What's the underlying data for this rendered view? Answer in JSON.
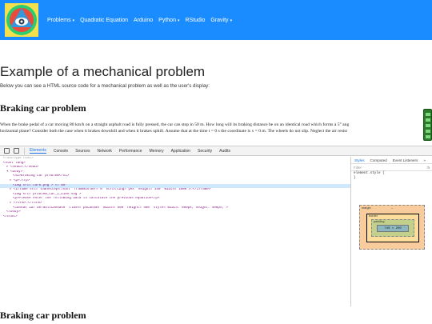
{
  "navbar": {
    "items": [
      {
        "label": "Problems",
        "caret": true
      },
      {
        "label": "Quadratic Equation",
        "caret": false
      },
      {
        "label": "Arduino",
        "caret": false
      },
      {
        "label": "Python",
        "caret": true
      },
      {
        "label": "RStudio",
        "caret": false
      },
      {
        "label": "Gravity",
        "caret": true
      }
    ],
    "caret_glyph": "▾"
  },
  "page": {
    "title": "Example of a mechanical problem",
    "intro": "Below you can see a HTML source code for a mechanical problem as well as the user's display:",
    "section_heading": "Braking car problem",
    "problem_line1": "When the brake pedal of a car moving 80 km/h on a straight asphalt road is fully pressed, the car can stop in 50 m. How long will its braking distance be on an identical road which forms a 5° ang",
    "problem_line2": "horizontal plane? Consider both the case when it brakes downhill and when it brakes uphill. Assume that at the time t = 0 s the coordinate is x = 0 m. The wheels do not slip. Neglect the air resist",
    "section_heading_2": "Braking car problem"
  },
  "devtools": {
    "tabs": [
      "Elements",
      "Console",
      "Sources",
      "Network",
      "Performance",
      "Memory",
      "Application",
      "Security",
      "Audits"
    ],
    "active_tab": "Elements",
    "code": [
      "<!doctype html>",
      "<html lang>",
      "▸ <head>…</head>",
      "▾ <body>",
      "<h1>Braking car problem</h1>",
      "▸ <p>…</p>",
      "<img src=\"car0.png\"> == $0",
      "▸ <iframe src=\"loanvsteps.html\" frameborder=\"0\" scrolling=\"yes\" height=\"340\" width=\"1000\">…</iframe>",
      "<img src=\"problem_car_1_bien.svg\">",
      "<p>Please enter the following data to calculate the previous equation</p>",
      "▸ <form>…</form>",
      "<canvas id=\"defaultCanvas0\" class=\"p5Canvas\" width=\"600\" height=\"400\" style=\"width: 600px; height: 400px;\">",
      "</body>",
      "</html>"
    ],
    "styles": {
      "tabs": [
        "Styles",
        "Computed",
        "Event Listeners",
        "»"
      ],
      "filter_placeholder": "Filter",
      "filter_hint": ":h",
      "rule_selector": "element.style {",
      "rule_close": "}",
      "box_model": {
        "margin_label": "margin",
        "border_label": "border",
        "padding_label": "padding",
        "content_size": "740 × 200",
        "dash": "–"
      }
    }
  }
}
